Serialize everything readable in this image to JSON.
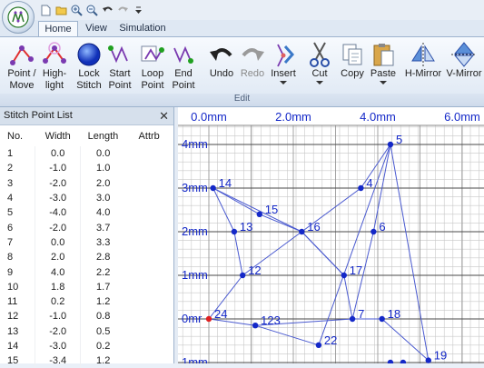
{
  "qat": [
    "new-icon",
    "open-icon",
    "zoom-in-icon",
    "zoom-out-icon",
    "undo-icon",
    "redo-icon",
    "customize-icon"
  ],
  "tabs": [
    "Home",
    "View",
    "Simulation"
  ],
  "ribbon": {
    "point_move": "Point /\nMove",
    "highlight": "High-\nlight",
    "lock_stitch": "Lock\nStitch",
    "start_point": "Start\nPoint",
    "loop_point": "Loop\nPoint",
    "end_point": "End\nPoint",
    "undo": "Undo",
    "redo": "Redo",
    "insert": "Insert",
    "cut": "Cut",
    "copy": "Copy",
    "paste": "Paste",
    "h_mirror": "H-Mirror",
    "v_mirror": "V-Mirror",
    "group_label": "Edit"
  },
  "panel": {
    "title": "Stitch Point List",
    "close": "✕",
    "columns": [
      "No.",
      "Width",
      "Length",
      "Attrb"
    ],
    "rows": [
      [
        "1",
        "0.0",
        "0.0",
        ""
      ],
      [
        "2",
        "-1.0",
        "1.0",
        ""
      ],
      [
        "3",
        "-2.0",
        "2.0",
        ""
      ],
      [
        "4",
        "-3.0",
        "3.0",
        ""
      ],
      [
        "5",
        "-4.0",
        "4.0",
        ""
      ],
      [
        "6",
        "-2.0",
        "3.7",
        ""
      ],
      [
        "7",
        "0.0",
        "3.3",
        ""
      ],
      [
        "8",
        "2.0",
        "2.8",
        ""
      ],
      [
        "9",
        "4.0",
        "2.2",
        ""
      ],
      [
        "10",
        "1.8",
        "1.7",
        ""
      ],
      [
        "11",
        "0.2",
        "1.2",
        ""
      ],
      [
        "12",
        "-1.0",
        "0.8",
        ""
      ],
      [
        "13",
        "-2.0",
        "0.5",
        ""
      ],
      [
        "14",
        "-3.0",
        "0.2",
        ""
      ],
      [
        "15",
        "-3.4",
        "1.2",
        ""
      ]
    ]
  },
  "canvas": {
    "x_labels": [
      "0.0mm",
      "2.0mm",
      "4.0mm",
      "6.0mm"
    ],
    "y_labels": [
      "4mm",
      "3mm",
      "2mm",
      "1mm",
      "0mr",
      "1mm"
    ],
    "points": [
      {
        "label": "5",
        "x": 4.3,
        "y": 4.0
      },
      {
        "label": "4",
        "x": 3.6,
        "y": 3.0
      },
      {
        "label": "14",
        "x": 0.1,
        "y": 3.0
      },
      {
        "label": "15",
        "x": 1.2,
        "y": 2.4
      },
      {
        "label": "13",
        "x": 0.6,
        "y": 2.0
      },
      {
        "label": "16",
        "x": 2.2,
        "y": 2.0
      },
      {
        "label": "6",
        "x": 3.9,
        "y": 2.0
      },
      {
        "label": "12",
        "x": 0.8,
        "y": 1.0
      },
      {
        "label": "17",
        "x": 3.2,
        "y": 1.0
      },
      {
        "label": "24",
        "x": 0.0,
        "y": 0.0
      },
      {
        "label": "123",
        "x": 1.1,
        "y": -0.15
      },
      {
        "label": "7",
        "x": 3.4,
        "y": 0.0
      },
      {
        "label": "18",
        "x": 4.1,
        "y": 0.0
      },
      {
        "label": "22",
        "x": 2.6,
        "y": -0.6
      },
      {
        "label": "19",
        "x": 5.2,
        "y": -0.95
      },
      {
        "label": "",
        "x": 4.3,
        "y": -1.0
      },
      {
        "label": "",
        "x": 4.6,
        "y": -1.0
      }
    ],
    "lines": [
      [
        "14",
        "16"
      ],
      [
        "16",
        "4"
      ],
      [
        "4",
        "5"
      ],
      [
        "5",
        "6"
      ],
      [
        "6",
        "7"
      ],
      [
        "7",
        "17"
      ],
      [
        "17",
        "16"
      ],
      [
        "14",
        "15"
      ],
      [
        "14",
        "13"
      ],
      [
        "13",
        "12"
      ],
      [
        "12",
        "24"
      ],
      [
        "12",
        "16"
      ],
      [
        "16",
        "17"
      ],
      [
        "15",
        "16"
      ],
      [
        "24",
        "123"
      ],
      [
        "123",
        "7"
      ],
      [
        "7",
        "18"
      ],
      [
        "18",
        "19"
      ],
      [
        "123",
        "22"
      ],
      [
        "22",
        "5"
      ],
      [
        "5",
        "19"
      ]
    ]
  },
  "colors": {
    "point": "#1428c8",
    "start_point": "#e02020",
    "line": "#4a5ad0",
    "grid_minor": "#c8c8c8",
    "grid_major": "#4a4a4a",
    "label": "#1428c8"
  }
}
